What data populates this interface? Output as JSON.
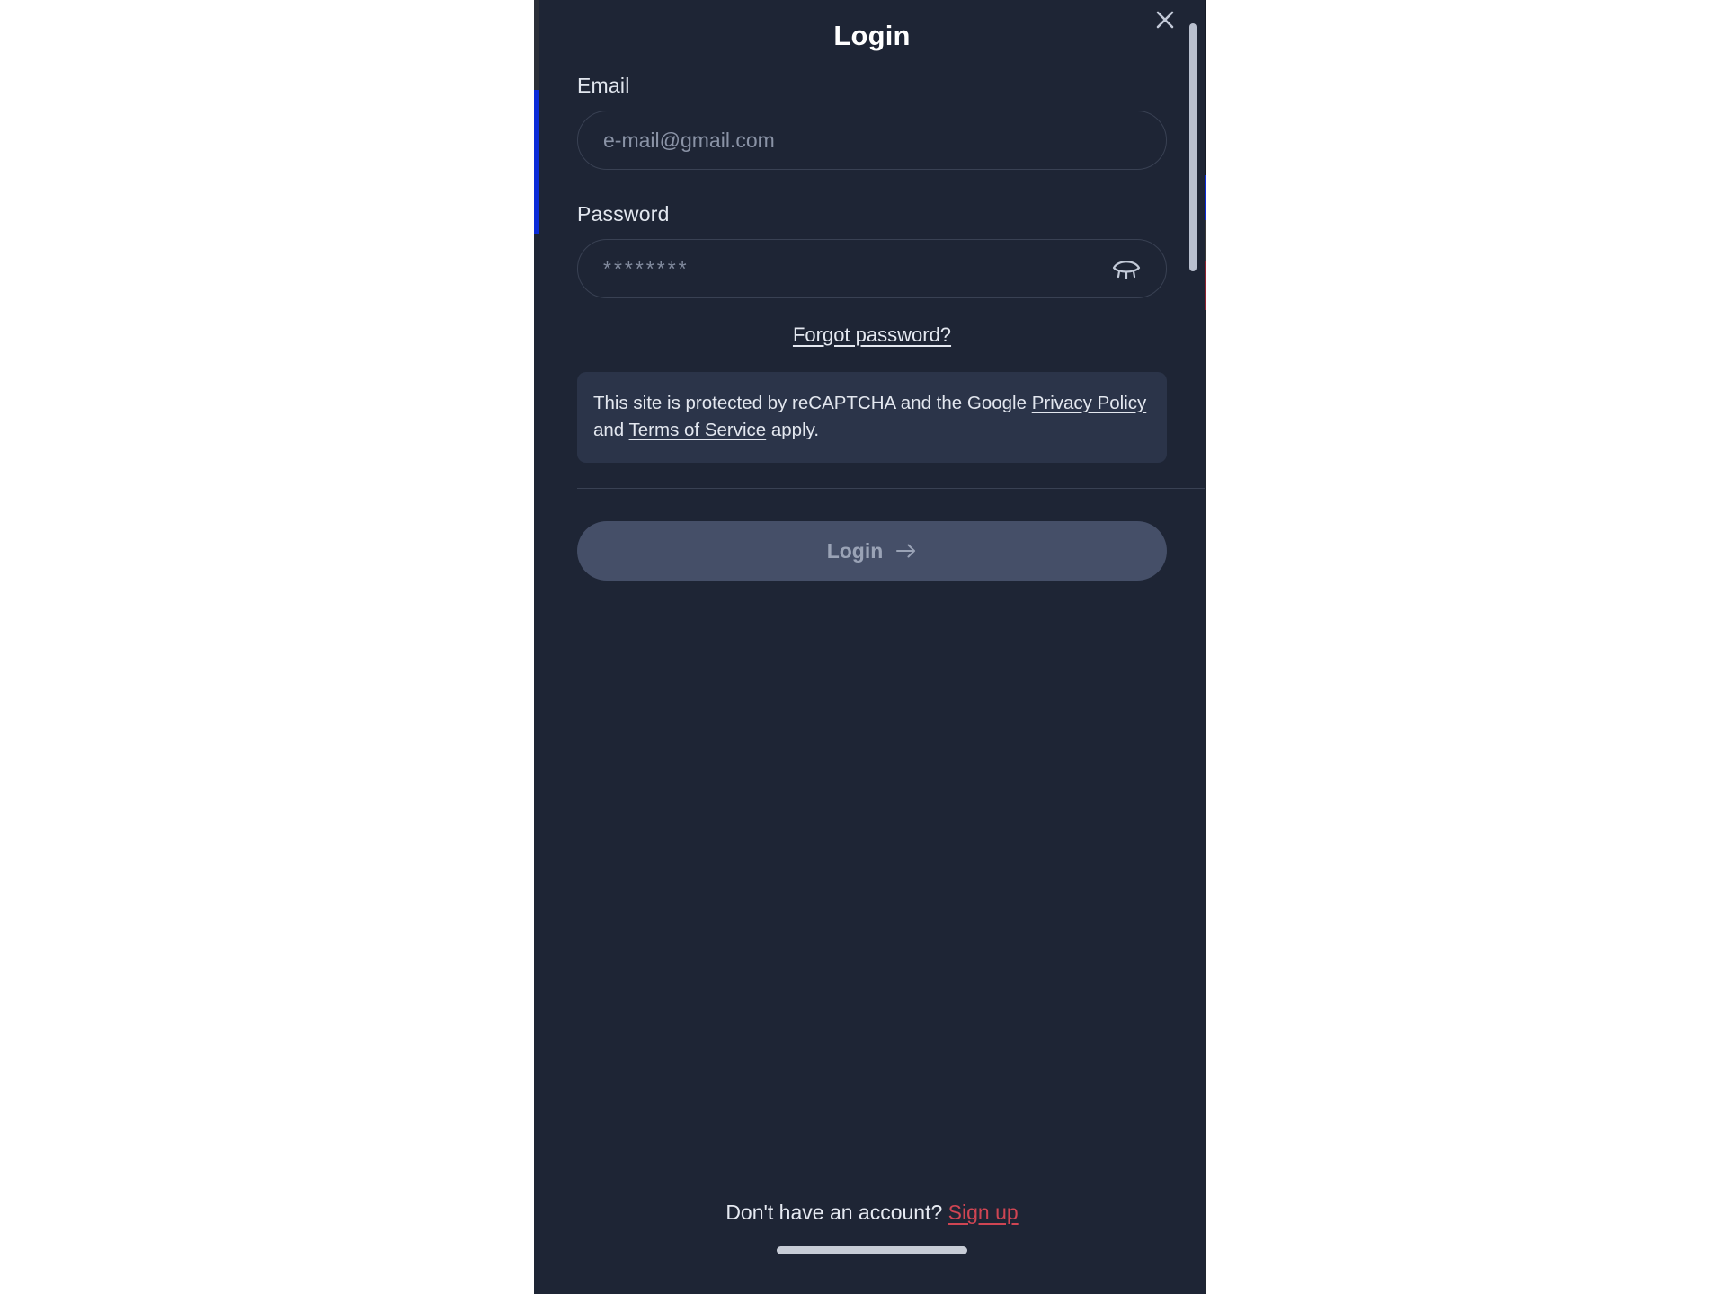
{
  "modal": {
    "title": "Login",
    "close_icon": "close-icon"
  },
  "form": {
    "email": {
      "label": "Email",
      "placeholder": "e-mail@gmail.com",
      "value": ""
    },
    "password": {
      "label": "Password",
      "placeholder": "********",
      "value": "",
      "toggle_icon": "eye-closed-icon"
    },
    "forgot_password_label": "Forgot password?"
  },
  "captcha": {
    "prefix": "This site is protected by reCAPTCHA and the Google ",
    "privacy_policy_label": "Privacy Policy",
    "conjunction": " and ",
    "terms_label": "Terms of Service",
    "suffix": " apply."
  },
  "actions": {
    "login_label": "Login",
    "login_arrow_icon": "arrow-right-icon"
  },
  "footer": {
    "prompt": "Don't have an account?",
    "signup_label": "Sign up"
  },
  "colors": {
    "sheet_background": "#1e2535",
    "captcha_background": "#2b3449",
    "login_button": "#454f68",
    "signup_link": "#cf4553",
    "border": "#394153",
    "text_primary": "#e6eaf2",
    "text_muted": "#8a93a6"
  }
}
